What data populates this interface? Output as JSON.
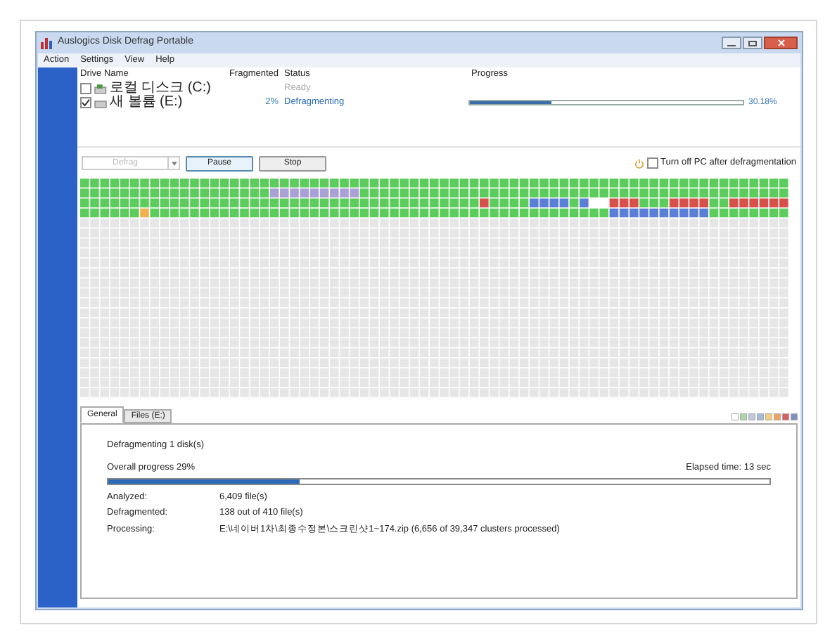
{
  "window": {
    "title": "Auslogics Disk Defrag Portable"
  },
  "menu": [
    "Action",
    "Settings",
    "View",
    "Help"
  ],
  "drives": {
    "columns": [
      "Drive Name",
      "Fragmented",
      "Status",
      "Progress"
    ],
    "rows": [
      {
        "checked": false,
        "name": "로컬 디스크 (C:)",
        "fragmented": "",
        "status": "Ready",
        "active": false
      },
      {
        "checked": true,
        "name": "새 볼륨 (E:)",
        "fragmented": "2%",
        "status": "Defragmenting",
        "active": true,
        "level": 0.3,
        "reading": "30.18%"
      }
    ]
  },
  "toolbar": {
    "defrag": "Defrag",
    "defrag_disabled": true,
    "pause": "Pause",
    "stop": "Stop",
    "shutdown_label": "Turn off PC after defragmentation",
    "shutdown_checked": false
  },
  "tabs": [
    {
      "label": "General",
      "selected": true
    },
    {
      "label": "Files (E:)",
      "selected": false
    }
  ],
  "general": {
    "heading": "Defragmenting 1 disk(s)",
    "overall": "Overall progress 29%",
    "elapsed": "Elapsed time: 13 sec",
    "level": 0.29,
    "stats": [
      {
        "label": "Analyzed:",
        "value": "6,409 file(s)"
      },
      {
        "label": "Defragmented:",
        "value": "138 out of 410 file(s)"
      },
      {
        "label": "Processing:",
        "value": "E:\\네이버1차\\최종수정본\\스크린샷1~174.zip (6,656 of 39,347 clusters processed)"
      }
    ]
  }
}
